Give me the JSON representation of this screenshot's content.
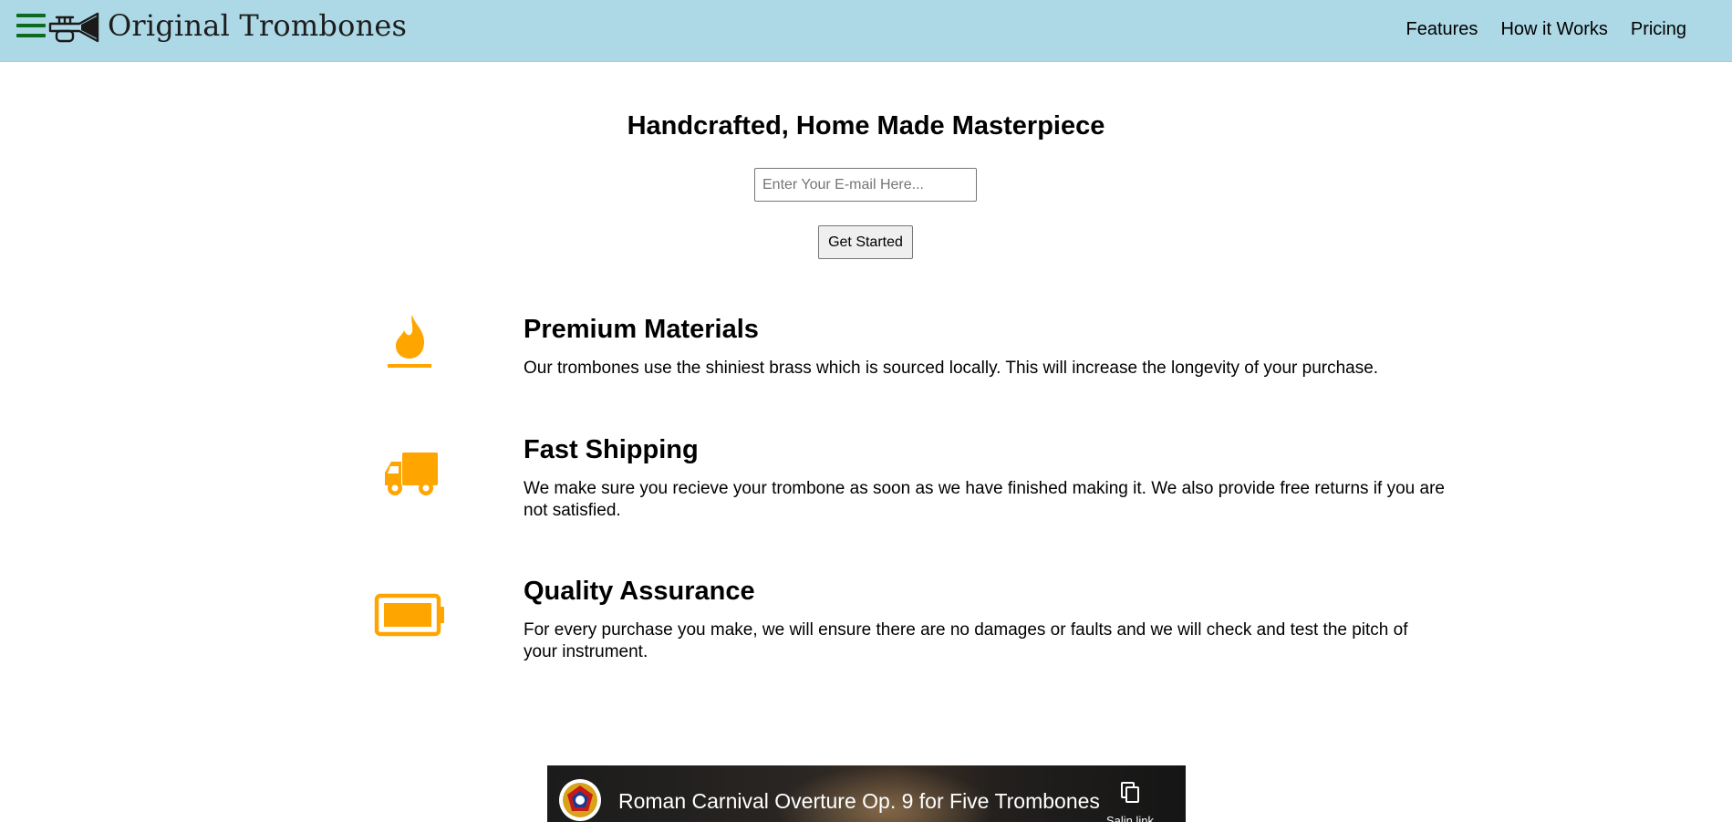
{
  "header": {
    "brand": "Original Trombones",
    "menu_icon": "hamburger-icon",
    "logo_icon": "trumpet-icon",
    "colors": {
      "background": "#add8e6",
      "menu": "#0d6b1f"
    },
    "nav": [
      {
        "label": "Features"
      },
      {
        "label": "How it Works"
      },
      {
        "label": "Pricing"
      }
    ]
  },
  "hero": {
    "title": "Handcrafted, Home Made Masterpiece",
    "email_placeholder": "Enter Your E-mail Here...",
    "button_label": "Get Started"
  },
  "features": [
    {
      "icon": "fire-icon",
      "title": "Premium Materials",
      "description": "Our trombones use the shiniest brass which is sourced locally. This will increase the longevity of your purchase."
    },
    {
      "icon": "truck-icon",
      "title": "Fast Shipping",
      "description": "We make sure you recieve your trombone as soon as we have finished making it. We also provide free returns if you are not satisfied."
    },
    {
      "icon": "battery-full-icon",
      "title": "Quality Assurance",
      "description": "For every purchase you make, we will ensure there are no damages or faults and we will check and test the pitch of your instrument."
    }
  ],
  "feature_icon_color": "#ffa500",
  "video": {
    "title": "Roman Carnival Overture Op. 9 for Five Trombones",
    "copy_link_label": "Salin link",
    "channel_icon": "channel-logo-icon",
    "copy_icon": "copy-icon"
  }
}
